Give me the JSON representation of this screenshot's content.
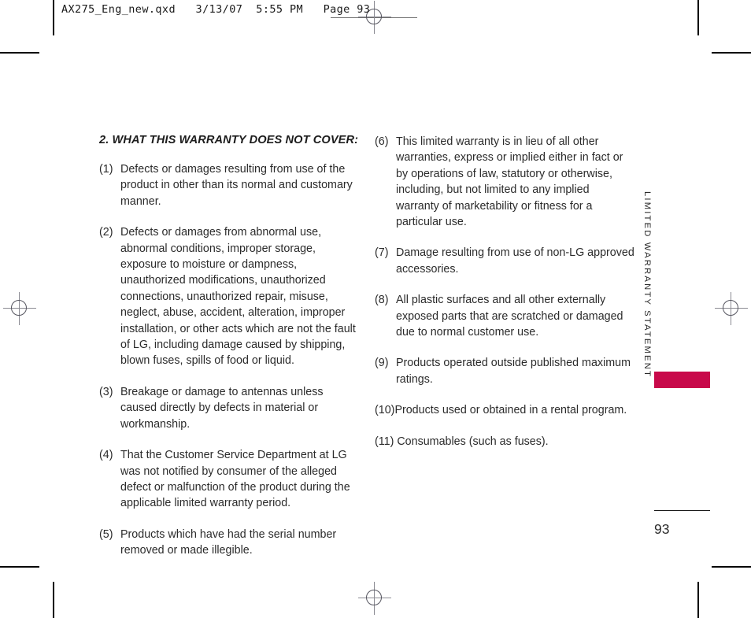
{
  "header": {
    "file_info": "AX275_Eng_new.qxd   3/13/07  5:55 PM   Page 93"
  },
  "section": {
    "heading": "2. WHAT THIS WARRANTY DOES NOT COVER:"
  },
  "clauses_left": [
    {
      "num": "(1)",
      "text": "Defects or damages resulting from use of the product in other than its normal and customary manner."
    },
    {
      "num": "(2)",
      "text": "Defects or damages from abnormal use, abnormal conditions, improper storage, exposure to moisture or dampness, unauthorized modifications, unauthorized connections, unauthorized repair, misuse, neglect, abuse, accident, alteration, improper installation, or other acts which are not the fault of LG, including damage caused by shipping, blown fuses, spills of food or liquid."
    },
    {
      "num": "(3)",
      "text": "Breakage or damage to antennas unless caused directly by defects in material or workmanship."
    },
    {
      "num": "(4)",
      "text": "That the Customer Service Department at LG was not notified by consumer of the alleged defect or malfunction of the product during the applicable limited warranty period."
    },
    {
      "num": "(5)",
      "text": "Products which have had the serial number removed or made illegible."
    }
  ],
  "clauses_right": [
    {
      "num": "(6)",
      "text": "This limited warranty is in lieu of all other warranties, express or implied either in fact or by operations of law, statutory or otherwise, including, but not limited to any implied warranty of marketability or fitness for a particular use."
    },
    {
      "num": "(7)",
      "text": "Damage resulting from use of non-LG approved accessories."
    },
    {
      "num": "(8)",
      "text": "All plastic surfaces and all other externally exposed parts that are scratched or damaged due to normal customer use."
    },
    {
      "num": "(9)",
      "text": "Products operated outside published maximum ratings."
    },
    {
      "num": "(10)",
      "text": "Products used or obtained in a rental program."
    },
    {
      "num": "(11)",
      "text": " Consumables (such as fuses)."
    }
  ],
  "running_head": {
    "text": "LIMITED WARRANTY STATEMENT"
  },
  "folio": {
    "page_number": "93"
  },
  "colors": {
    "thumb_tab": "#c8094a",
    "body_text": "#2b2b2b",
    "rule": "#1a1a1a"
  }
}
